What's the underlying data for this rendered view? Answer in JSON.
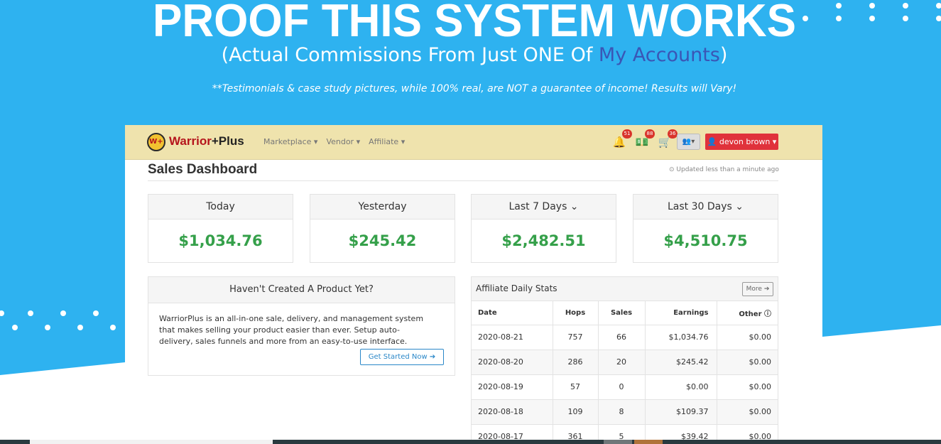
{
  "hero": {
    "title": "PROOF THIS SYSTEM WORKS",
    "subtitle_pre": "(Actual Commissions From Just ONE Of ",
    "subtitle_accent": "My Accounts",
    "subtitle_post": ")",
    "disclaimer": "**Testimonials & case study pictures, while 100% real, are NOT a guarantee of income! Results will Vary!"
  },
  "nav": {
    "logo_icon": "warriorplus-logo",
    "logo_w": "Warrior",
    "logo_rest": "+Plus",
    "menu": [
      "Marketplace ▾",
      "Vendor ▾",
      "Affiliate ▾"
    ],
    "icons": [
      {
        "icon": "bell-icon",
        "badge": "51"
      },
      {
        "icon": "money-icon",
        "badge": "88"
      },
      {
        "icon": "cart-icon",
        "badge": "36"
      }
    ],
    "user": "devon brown ▾"
  },
  "dashboard": {
    "title": "Sales Dashboard",
    "updated": "⊙ Updated less than a minute ago"
  },
  "stats": [
    {
      "label": "Today",
      "value": "$1,034.76"
    },
    {
      "label": "Yesterday",
      "value": "$245.42"
    },
    {
      "label": "Last 7 Days ⌄",
      "value": "$2,482.51"
    },
    {
      "label": "Last 30 Days ⌄",
      "value": "$4,510.75"
    }
  ],
  "promo": {
    "title": "Haven't Created A Product Yet?",
    "body": "WarriorPlus is an all-in-one sale, delivery, and management system that makes selling your product easier than ever. Setup auto-delivery, sales funnels and more from an easy-to-use interface.",
    "cta": "Get Started Now ➔"
  },
  "affiliate": {
    "title": "Affiliate Daily Stats",
    "more": "More ➔",
    "columns": [
      "Date",
      "Hops",
      "Sales",
      "Earnings",
      "Other ⓘ"
    ],
    "rows": [
      [
        "2020-08-21",
        "757",
        "66",
        "$1,034.76",
        "$0.00"
      ],
      [
        "2020-08-20",
        "286",
        "20",
        "$245.42",
        "$0.00"
      ],
      [
        "2020-08-19",
        "57",
        "0",
        "$0.00",
        "$0.00"
      ],
      [
        "2020-08-18",
        "109",
        "8",
        "$109.37",
        "$0.00"
      ],
      [
        "2020-08-17",
        "361",
        "5",
        "$39.42",
        "$0.00"
      ]
    ]
  },
  "colors": {
    "background": "#2eb2f0",
    "accent": "#3a56b6",
    "money_green": "#35a04a",
    "user_button": "#e0323b"
  }
}
